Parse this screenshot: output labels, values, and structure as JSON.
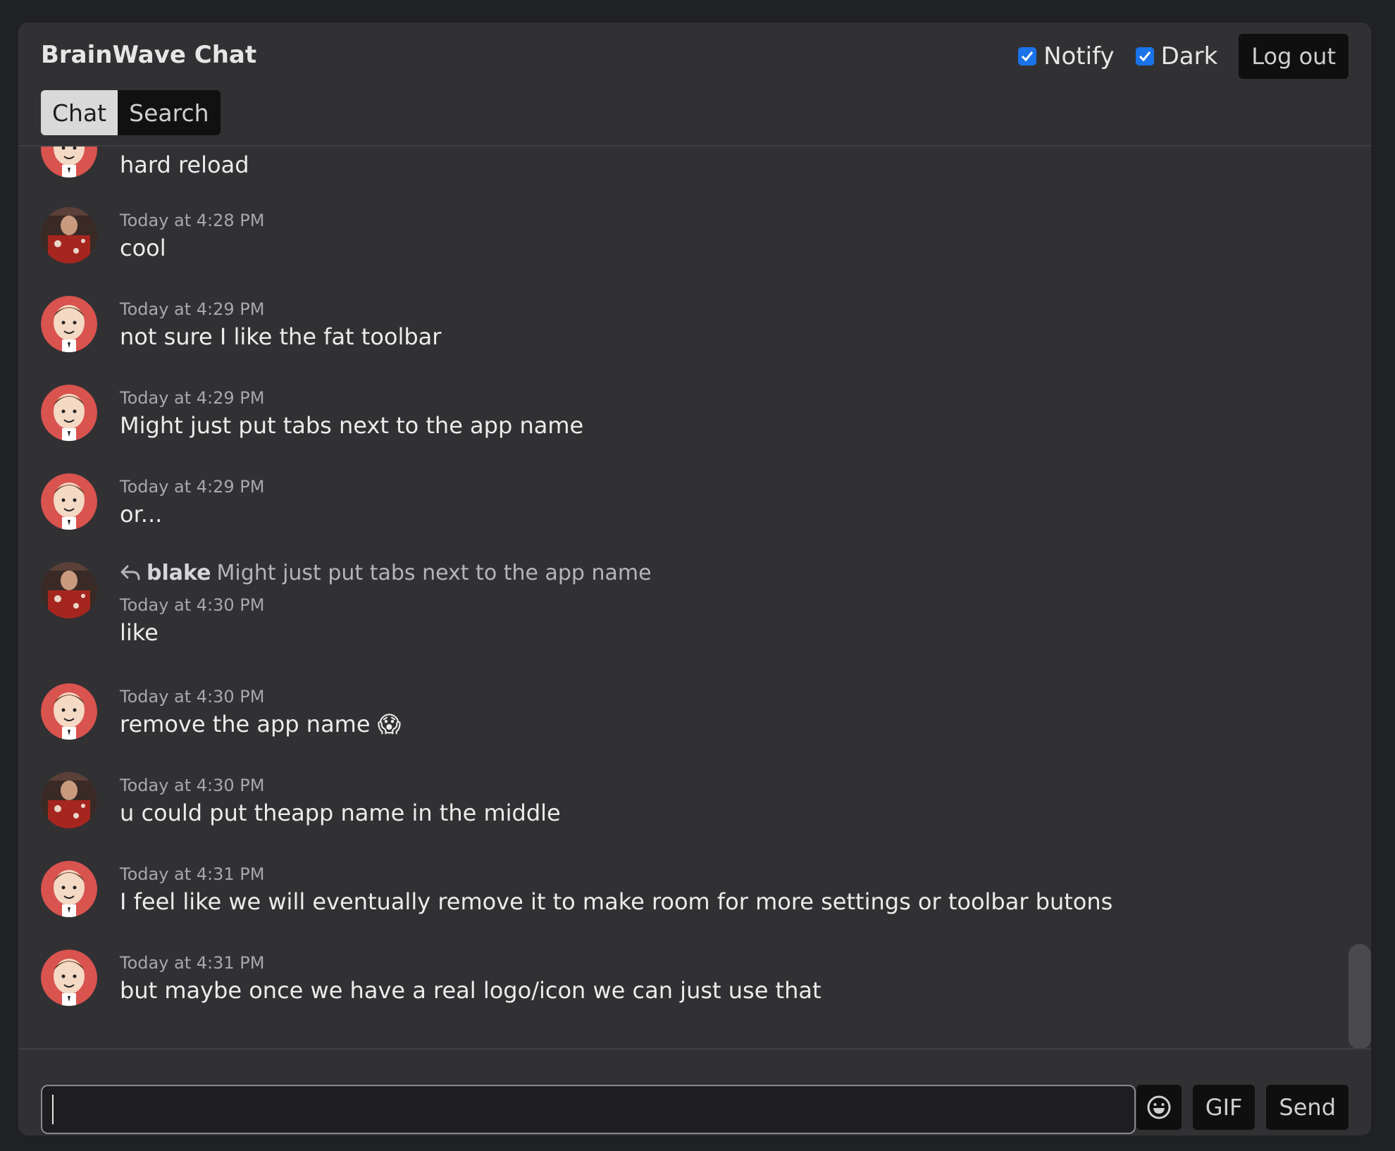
{
  "app": {
    "title": "BrainWave Chat",
    "notify_label": "Notify",
    "notify_checked": true,
    "dark_label": "Dark",
    "dark_checked": true,
    "logout_label": "Log out",
    "tabs": [
      {
        "label": "Chat",
        "active": true
      },
      {
        "label": "Search",
        "active": false
      }
    ]
  },
  "messages": [
    {
      "avatar": "cartoon-avatar",
      "timestamp": "",
      "text": "hard reload"
    },
    {
      "avatar": "photo-avatar",
      "timestamp": "Today at 4:28 PM",
      "text": "cool"
    },
    {
      "avatar": "cartoon-avatar",
      "timestamp": "Today at 4:29 PM",
      "text": "not sure I like the fat toolbar"
    },
    {
      "avatar": "cartoon-avatar",
      "timestamp": "Today at 4:29 PM",
      "text": "Might just put tabs next to the app name"
    },
    {
      "avatar": "cartoon-avatar",
      "timestamp": "Today at 4:29 PM",
      "text": "or..."
    },
    {
      "avatar": "photo-avatar",
      "reply_user": "blake",
      "reply_text": "Might just put tabs next to the app name",
      "timestamp": "Today at 4:30 PM",
      "text": "like"
    },
    {
      "avatar": "cartoon-avatar",
      "timestamp": "Today at 4:30 PM",
      "text": "remove the app name",
      "emoji": "😱"
    },
    {
      "avatar": "photo-avatar",
      "timestamp": "Today at 4:30 PM",
      "text": "u could put theapp name in the middle"
    },
    {
      "avatar": "cartoon-avatar",
      "timestamp": "Today at 4:31 PM",
      "text": "I feel like we will eventually remove it to make room for more settings or toolbar butons"
    },
    {
      "avatar": "cartoon-avatar",
      "timestamp": "Today at 4:31 PM",
      "text": "but maybe once we have a real logo/icon we can just use that"
    }
  ],
  "composer": {
    "value": "",
    "placeholder": "",
    "emoji_icon": "smiley-icon",
    "gif_label": "GIF",
    "send_label": "Send"
  },
  "colors": {
    "background": "#202124",
    "panel": "#313134",
    "accent": "#1a73e8",
    "button": "#0f0f10"
  }
}
